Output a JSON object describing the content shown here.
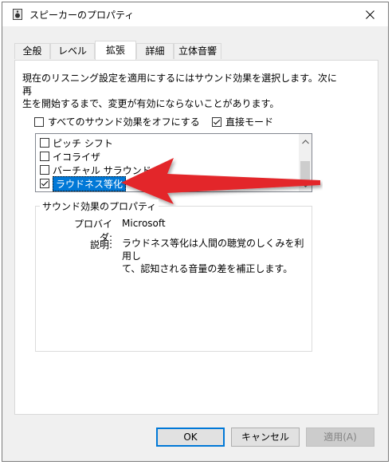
{
  "window": {
    "title": "スピーカーのプロパティ",
    "close_glyph": "✕"
  },
  "tabs": [
    {
      "label": "全般",
      "active": false
    },
    {
      "label": "レベル",
      "active": false
    },
    {
      "label": "拡張",
      "active": true
    },
    {
      "label": "詳細",
      "active": false
    },
    {
      "label": "立体音響",
      "active": false
    }
  ],
  "enhancements": {
    "description_line1": "現在のリスニング設定を適用にするにはサウンド効果を選択します。次に再",
    "description_line2": "生を開始するまで、変更が有効にならないことがあります。",
    "disable_all_label": "すべてのサウンド効果をオフにする",
    "disable_all_checked": false,
    "immediate_mode_label": "直接モード",
    "immediate_mode_checked": true,
    "effects": [
      {
        "label": "ピッチ シフト",
        "checked": false
      },
      {
        "label": "イコライザ",
        "checked": false
      },
      {
        "label": "バーチャル サラウンド",
        "checked": false
      },
      {
        "label": "ラウドネス等化",
        "checked": true,
        "selected": true
      }
    ]
  },
  "properties": {
    "group_title": "サウンド効果のプロパティ",
    "provider_label": "プロバイダ:",
    "provider_value": "Microsoft",
    "description_label": "説明:",
    "description_line1": "ラウドネス等化は人間の聴覚のしくみを利用し",
    "description_line2": "て、認知される音量の差を補正します。"
  },
  "buttons": {
    "ok": "OK",
    "cancel": "キャンセル",
    "apply": "適用(A)"
  },
  "colors": {
    "accent": "#0078d7",
    "annotation_arrow": "#e3262b"
  },
  "icons": {
    "title": "speaker-icon",
    "close": "close-icon",
    "scroll_up": "scroll-up-arrow-icon",
    "scroll_down": "scroll-down-arrow-icon"
  }
}
